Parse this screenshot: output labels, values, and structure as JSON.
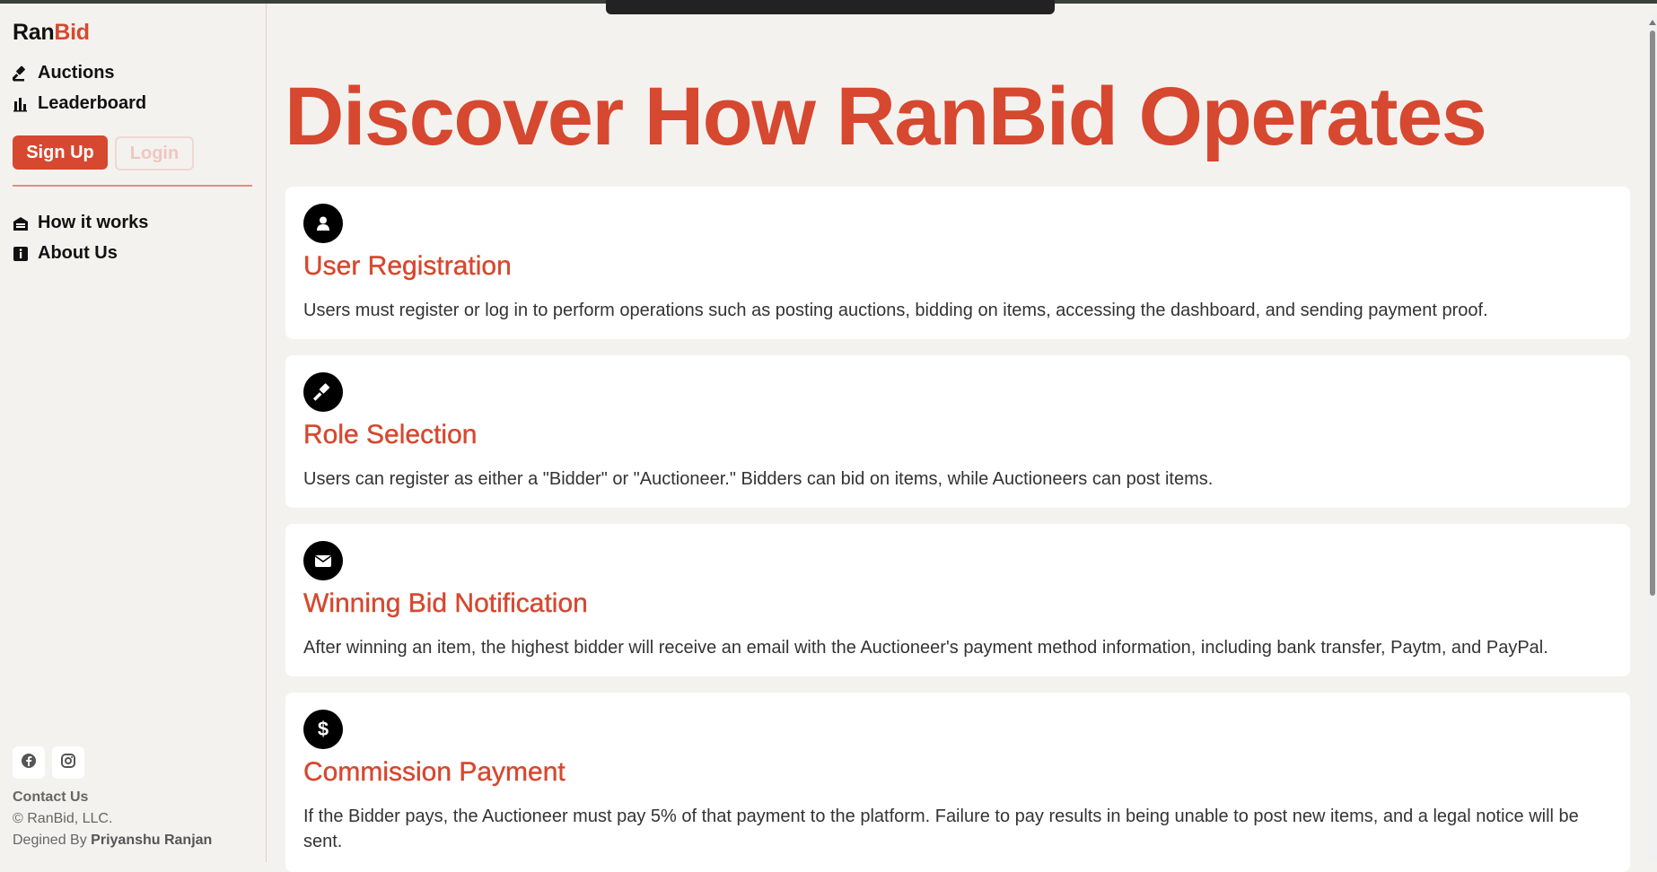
{
  "sidebar": {
    "logo_part1": "Ran",
    "logo_part2": "Bid",
    "nav": [
      {
        "label": "Auctions",
        "icon": "gavel-icon"
      },
      {
        "label": "Leaderboard",
        "icon": "bar-chart-icon"
      }
    ],
    "signup_label": "Sign Up",
    "login_label": "Login",
    "secondary_nav": [
      {
        "label": "How it works",
        "icon": "garage-icon"
      },
      {
        "label": "About Us",
        "icon": "info-icon"
      }
    ],
    "social": [
      "facebook-icon",
      "instagram-icon"
    ],
    "contact_label": "Contact Us",
    "copyright": "© RanBid, LLC.",
    "designed_prefix": "Degined By ",
    "designed_name": "Priyanshu Ranjan"
  },
  "main": {
    "title": "Discover How RanBid Operates",
    "cards": [
      {
        "icon": "user-icon",
        "title": "User Registration",
        "text": "Users must register or log in to perform operations such as posting auctions, bidding on items, accessing the dashboard, and sending payment proof."
      },
      {
        "icon": "gavel-icon",
        "title": "Role Selection",
        "text": "Users can register as either a \"Bidder\" or \"Auctioneer.\" Bidders can bid on items, while Auctioneers can post items."
      },
      {
        "icon": "envelope-icon",
        "title": "Winning Bid Notification",
        "text": "After winning an item, the highest bidder will receive an email with the Auctioneer's payment method information, including bank transfer, Paytm, and PayPal."
      },
      {
        "icon": "dollar-icon",
        "title": "Commission Payment",
        "text": "If the Bidder pays, the Auctioneer must pay 5% of that payment to the platform. Failure to pay results in being unable to post new items, and a legal notice will be sent."
      }
    ]
  },
  "colors": {
    "accent": "#d6482f",
    "background": "#f4f2ef",
    "card": "#ffffff"
  }
}
